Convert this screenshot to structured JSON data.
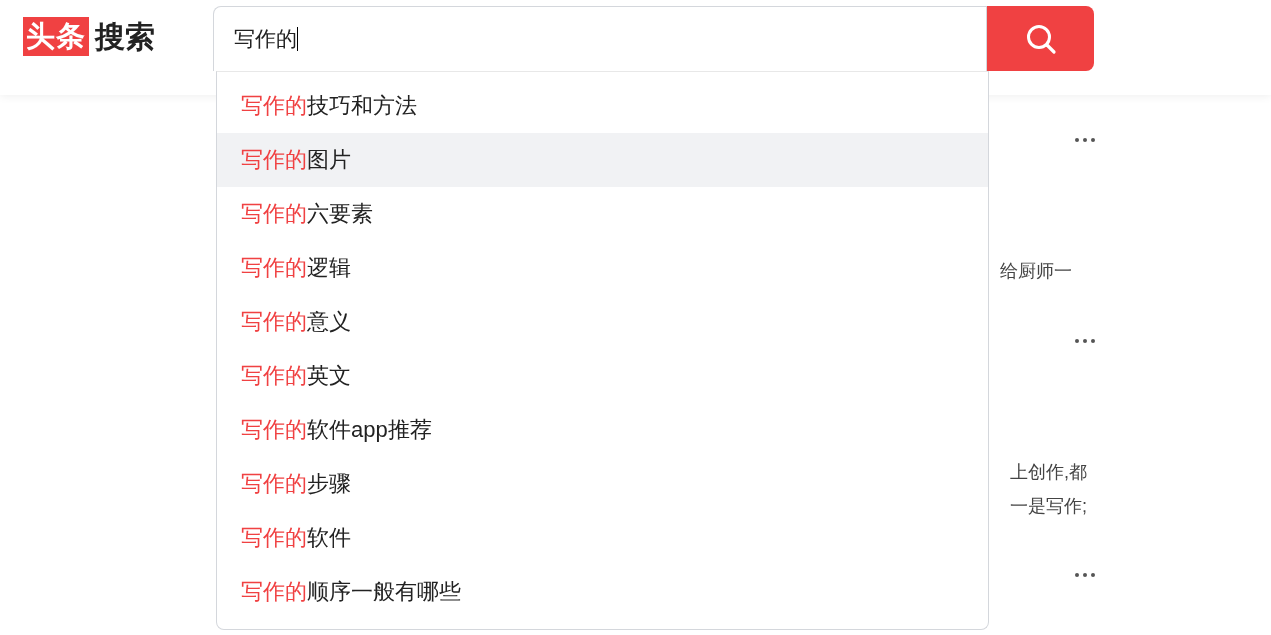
{
  "logo": {
    "badge": "头条",
    "text": "搜索"
  },
  "search": {
    "value": "写作的"
  },
  "suggestions": [
    {
      "match": "写作的",
      "rest": "技巧和方法",
      "selected": false
    },
    {
      "match": "写作的",
      "rest": "图片",
      "selected": true
    },
    {
      "match": "写作的",
      "rest": "六要素",
      "selected": false
    },
    {
      "match": "写作的",
      "rest": "逻辑",
      "selected": false
    },
    {
      "match": "写作的",
      "rest": "意义",
      "selected": false
    },
    {
      "match": "写作的",
      "rest": "英文",
      "selected": false
    },
    {
      "match": "写作的",
      "rest": "软件app推荐",
      "selected": false
    },
    {
      "match": "写作的",
      "rest": "步骤",
      "selected": false
    },
    {
      "match": "写作的",
      "rest": "软件",
      "selected": false
    },
    {
      "match": "写作的",
      "rest": "顺序一般有哪些",
      "selected": false
    }
  ],
  "results": [
    {
      "snippet_lines": [
        "给厨师一"
      ]
    },
    {
      "snippet_lines": [
        "上创作,都",
        "一是写作;"
      ]
    }
  ]
}
